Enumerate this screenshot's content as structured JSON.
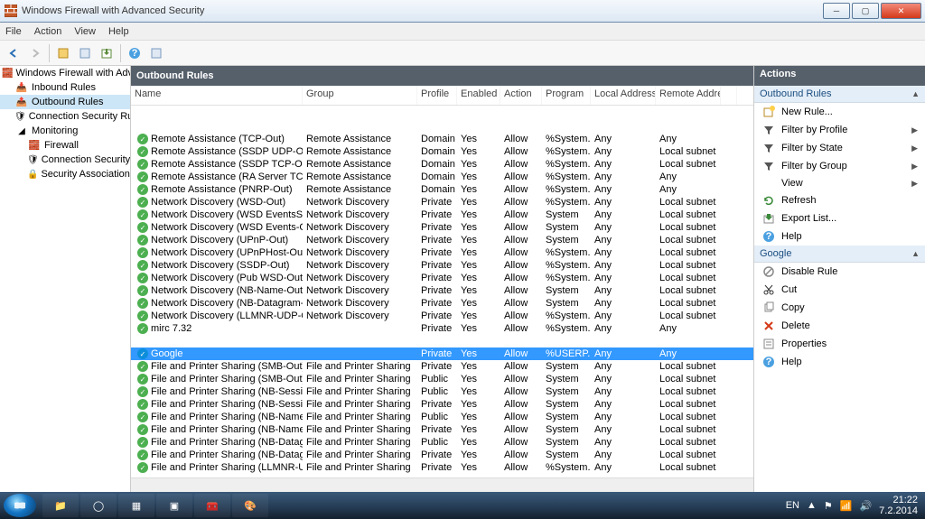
{
  "window": {
    "title": "Windows Firewall with Advanced Security"
  },
  "menubar": [
    "File",
    "Action",
    "View",
    "Help"
  ],
  "tree": {
    "root": "Windows Firewall with Advance",
    "inbound": "Inbound Rules",
    "outbound": "Outbound Rules",
    "consec": "Connection Security Ru",
    "monitoring": "Monitoring",
    "firewall": "Firewall",
    "consec2": "Connection Security Rul",
    "secassoc": "Security Associations"
  },
  "main": {
    "title": "Outbound Rules",
    "columns": [
      "Name",
      "Group",
      "Profile",
      "Enabled",
      "Action",
      "Program",
      "Local Address",
      "Remote Address"
    ],
    "rows": [
      {
        "name": "Remote Assistance (TCP-Out)",
        "group": "Remote Assistance",
        "profile": "Domain",
        "enabled": "Yes",
        "action": "Allow",
        "program": "%System...",
        "local": "Any",
        "remote": "Any"
      },
      {
        "name": "Remote Assistance (SSDP UDP-Out)",
        "group": "Remote Assistance",
        "profile": "Domain",
        "enabled": "Yes",
        "action": "Allow",
        "program": "%System...",
        "local": "Any",
        "remote": "Local subnet"
      },
      {
        "name": "Remote Assistance (SSDP TCP-Out)",
        "group": "Remote Assistance",
        "profile": "Domain",
        "enabled": "Yes",
        "action": "Allow",
        "program": "%System...",
        "local": "Any",
        "remote": "Local subnet"
      },
      {
        "name": "Remote Assistance (RA Server TCP-Out)",
        "group": "Remote Assistance",
        "profile": "Domain",
        "enabled": "Yes",
        "action": "Allow",
        "program": "%System...",
        "local": "Any",
        "remote": "Any"
      },
      {
        "name": "Remote Assistance (PNRP-Out)",
        "group": "Remote Assistance",
        "profile": "Domain",
        "enabled": "Yes",
        "action": "Allow",
        "program": "%System...",
        "local": "Any",
        "remote": "Any"
      },
      {
        "name": "Network Discovery (WSD-Out)",
        "group": "Network Discovery",
        "profile": "Private",
        "enabled": "Yes",
        "action": "Allow",
        "program": "%System...",
        "local": "Any",
        "remote": "Local subnet"
      },
      {
        "name": "Network Discovery (WSD EventsSecure-O...",
        "group": "Network Discovery",
        "profile": "Private",
        "enabled": "Yes",
        "action": "Allow",
        "program": "System",
        "local": "Any",
        "remote": "Local subnet"
      },
      {
        "name": "Network Discovery (WSD Events-Out)",
        "group": "Network Discovery",
        "profile": "Private",
        "enabled": "Yes",
        "action": "Allow",
        "program": "System",
        "local": "Any",
        "remote": "Local subnet"
      },
      {
        "name": "Network Discovery (UPnP-Out)",
        "group": "Network Discovery",
        "profile": "Private",
        "enabled": "Yes",
        "action": "Allow",
        "program": "System",
        "local": "Any",
        "remote": "Local subnet"
      },
      {
        "name": "Network Discovery (UPnPHost-Out)",
        "group": "Network Discovery",
        "profile": "Private",
        "enabled": "Yes",
        "action": "Allow",
        "program": "%System...",
        "local": "Any",
        "remote": "Local subnet"
      },
      {
        "name": "Network Discovery (SSDP-Out)",
        "group": "Network Discovery",
        "profile": "Private",
        "enabled": "Yes",
        "action": "Allow",
        "program": "%System...",
        "local": "Any",
        "remote": "Local subnet"
      },
      {
        "name": "Network Discovery (Pub WSD-Out)",
        "group": "Network Discovery",
        "profile": "Private",
        "enabled": "Yes",
        "action": "Allow",
        "program": "%System...",
        "local": "Any",
        "remote": "Local subnet"
      },
      {
        "name": "Network Discovery (NB-Name-Out)",
        "group": "Network Discovery",
        "profile": "Private",
        "enabled": "Yes",
        "action": "Allow",
        "program": "System",
        "local": "Any",
        "remote": "Local subnet"
      },
      {
        "name": "Network Discovery (NB-Datagram-Out)",
        "group": "Network Discovery",
        "profile": "Private",
        "enabled": "Yes",
        "action": "Allow",
        "program": "System",
        "local": "Any",
        "remote": "Local subnet"
      },
      {
        "name": "Network Discovery (LLMNR-UDP-Out)",
        "group": "Network Discovery",
        "profile": "Private",
        "enabled": "Yes",
        "action": "Allow",
        "program": "%System...",
        "local": "Any",
        "remote": "Local subnet"
      },
      {
        "name": "mirc 7.32",
        "group": "",
        "profile": "Private",
        "enabled": "Yes",
        "action": "Allow",
        "program": "%System...",
        "local": "Any",
        "remote": "Any"
      },
      {
        "gap": true
      },
      {
        "name": "Google",
        "group": "",
        "profile": "Private",
        "enabled": "Yes",
        "action": "Allow",
        "program": "%USERP...",
        "local": "Any",
        "remote": "Any",
        "selected": true,
        "blue": true
      },
      {
        "name": "File and Printer Sharing (SMB-Out)",
        "group": "File and Printer Sharing",
        "profile": "Private",
        "enabled": "Yes",
        "action": "Allow",
        "program": "System",
        "local": "Any",
        "remote": "Local subnet"
      },
      {
        "name": "File and Printer Sharing (SMB-Out)",
        "group": "File and Printer Sharing",
        "profile": "Public",
        "enabled": "Yes",
        "action": "Allow",
        "program": "System",
        "local": "Any",
        "remote": "Local subnet"
      },
      {
        "name": "File and Printer Sharing (NB-Session-Out)",
        "group": "File and Printer Sharing",
        "profile": "Public",
        "enabled": "Yes",
        "action": "Allow",
        "program": "System",
        "local": "Any",
        "remote": "Local subnet"
      },
      {
        "name": "File and Printer Sharing (NB-Session-Out)",
        "group": "File and Printer Sharing",
        "profile": "Private",
        "enabled": "Yes",
        "action": "Allow",
        "program": "System",
        "local": "Any",
        "remote": "Local subnet"
      },
      {
        "name": "File and Printer Sharing (NB-Name-Out)",
        "group": "File and Printer Sharing",
        "profile": "Public",
        "enabled": "Yes",
        "action": "Allow",
        "program": "System",
        "local": "Any",
        "remote": "Local subnet"
      },
      {
        "name": "File and Printer Sharing (NB-Name-Out)",
        "group": "File and Printer Sharing",
        "profile": "Private",
        "enabled": "Yes",
        "action": "Allow",
        "program": "System",
        "local": "Any",
        "remote": "Local subnet"
      },
      {
        "name": "File and Printer Sharing (NB-Datagram-O...",
        "group": "File and Printer Sharing",
        "profile": "Public",
        "enabled": "Yes",
        "action": "Allow",
        "program": "System",
        "local": "Any",
        "remote": "Local subnet"
      },
      {
        "name": "File and Printer Sharing (NB-Datagram-O...",
        "group": "File and Printer Sharing",
        "profile": "Private",
        "enabled": "Yes",
        "action": "Allow",
        "program": "System",
        "local": "Any",
        "remote": "Local subnet"
      },
      {
        "name": "File and Printer Sharing (LLMNR-UDP-Out)",
        "group": "File and Printer Sharing",
        "profile": "Private",
        "enabled": "Yes",
        "action": "Allow",
        "program": "%System...",
        "local": "Any",
        "remote": "Local subnet"
      }
    ]
  },
  "actions": {
    "title": "Actions",
    "section1": "Outbound Rules",
    "items1": [
      {
        "icon": "new",
        "label": "New Rule..."
      },
      {
        "icon": "filter",
        "label": "Filter by Profile",
        "arrow": true
      },
      {
        "icon": "filter",
        "label": "Filter by State",
        "arrow": true
      },
      {
        "icon": "filter",
        "label": "Filter by Group",
        "arrow": true
      },
      {
        "icon": "",
        "label": "View",
        "arrow": true
      },
      {
        "icon": "refresh",
        "label": "Refresh"
      },
      {
        "icon": "export",
        "label": "Export List..."
      },
      {
        "icon": "help",
        "label": "Help"
      }
    ],
    "section2": "Google",
    "items2": [
      {
        "icon": "disable",
        "label": "Disable Rule"
      },
      {
        "icon": "cut",
        "label": "Cut"
      },
      {
        "icon": "copy",
        "label": "Copy"
      },
      {
        "icon": "delete",
        "label": "Delete"
      },
      {
        "icon": "props",
        "label": "Properties"
      },
      {
        "icon": "help",
        "label": "Help"
      }
    ]
  },
  "taskbar": {
    "lang": "EN",
    "time": "21:22",
    "date": "7.2.2014"
  }
}
